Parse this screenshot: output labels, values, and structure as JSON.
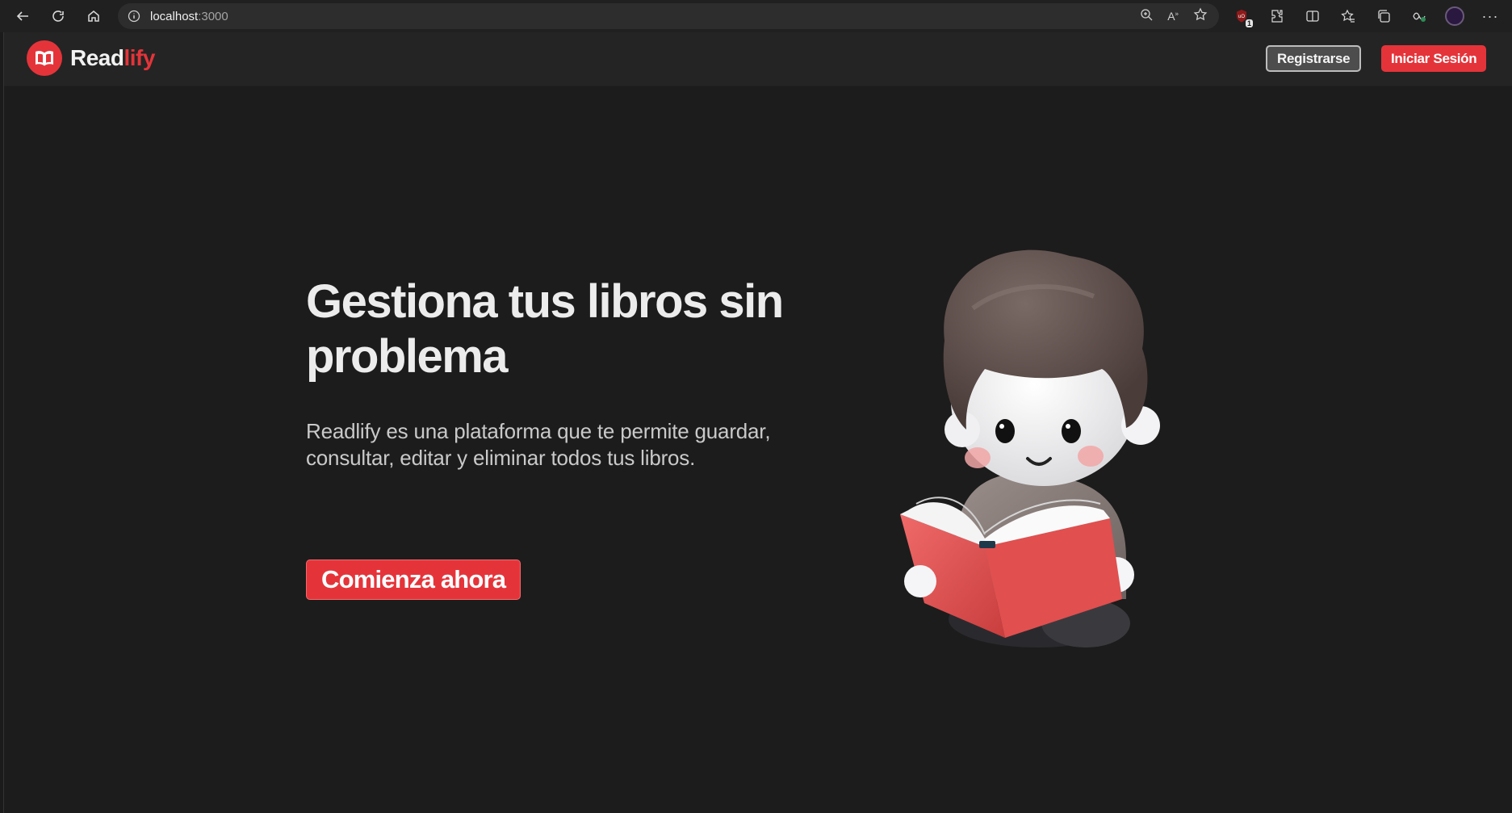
{
  "browser": {
    "url_host": "localhost",
    "url_port": ":3000",
    "ublock_count": "1",
    "icons": [
      "back-icon",
      "refresh-icon",
      "home-icon",
      "info-icon",
      "zoom-icon",
      "read-aloud-icon",
      "favorite-star-icon",
      "ublock-icon",
      "extensions-icon",
      "split-screen-icon",
      "favorites-icon",
      "collections-icon",
      "performance-icon",
      "profile-avatar",
      "more-icon"
    ]
  },
  "header": {
    "logo_text_a": "Read",
    "logo_text_b": "lify",
    "register_label": "Registrarse",
    "login_label": "Iniciar Sesión"
  },
  "hero": {
    "title": "Gestiona tus libros sin problema",
    "description": "Readlify es una plataforma que te permite guardar, consultar, editar y eliminar todos tus libros.",
    "cta_label": "Comienza ahora",
    "illustration": "boy-reading-book-illustration"
  },
  "colors": {
    "accent": "#e4343a",
    "background": "#1c1c1c",
    "header": "#242424"
  }
}
